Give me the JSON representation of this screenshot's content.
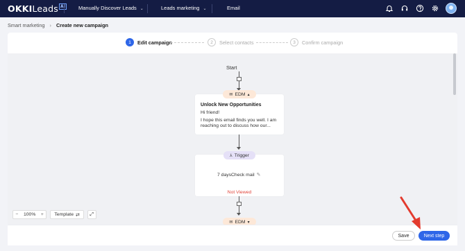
{
  "brand": {
    "logo_main": "OKKI",
    "logo_sub": "Leads",
    "logo_badge": "AI"
  },
  "nav": {
    "items": [
      {
        "label": "Manually Discover Leads"
      },
      {
        "label": "Leads marketing"
      },
      {
        "label": "Email"
      }
    ],
    "icons": [
      "bell-icon",
      "headset-icon",
      "help-icon",
      "gear-icon"
    ]
  },
  "breadcrumb": {
    "parent": "Smart marketing",
    "current": "Create new campaign"
  },
  "steps": [
    {
      "num": "1",
      "label": "Edit campaign"
    },
    {
      "num": "2",
      "label": "Select contacts"
    },
    {
      "num": "3",
      "label": "Confirm campaign"
    }
  ],
  "flow": {
    "start_label": "Start",
    "edm_label": "EDM",
    "email_card": {
      "title": "Unlock New Opportunities",
      "greeting": "Hi friend!",
      "body": "I hope this email finds you well. I am reaching out to discuss how our..."
    },
    "trigger_label": "Trigger",
    "wait_label": "7 daysCheck mail",
    "condition_label": "Not Viewed",
    "edm_label_2": "EDM"
  },
  "toolbar": {
    "zoom_value": "100%",
    "zoom_minus": "−",
    "zoom_plus": "+",
    "template_label": "Template"
  },
  "footer": {
    "save_label": "Save",
    "next_label": "Next step"
  },
  "colors": {
    "nav_bg": "#141c44",
    "accent": "#2e66e8",
    "edm_chip": "#fde8d8",
    "trigger_chip": "#e5e0f7",
    "not_viewed": "#e0453b",
    "annotation_arrow": "#e33b2e"
  }
}
